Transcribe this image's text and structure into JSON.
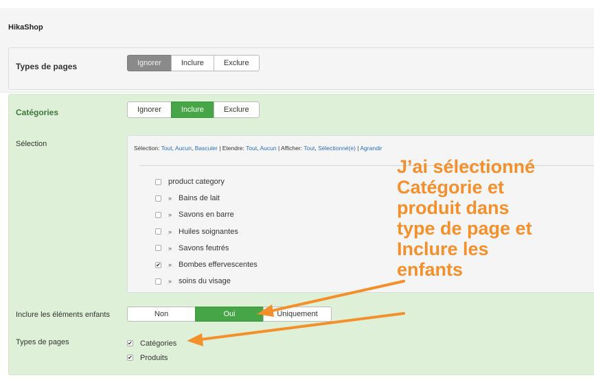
{
  "header": {
    "app_title": "HikaShop"
  },
  "types_section": {
    "label": "Types de pages",
    "options": [
      "Ignorer",
      "Inclure",
      "Exclure"
    ],
    "selected": "Ignorer"
  },
  "categories_section": {
    "label": "Catégories",
    "options": [
      "Ignorer",
      "Inclure",
      "Exclure"
    ],
    "selected": "Inclure",
    "selection_label": "Sélection",
    "toolbar": {
      "selection_prefix": "Sélection:",
      "tout": "Tout",
      "aucun": "Aucun",
      "basculer": "Basculer",
      "etendre_prefix": "Etendre:",
      "etendre_tout": "Tout",
      "etendre_aucun": "Aucun",
      "afficher_prefix": "Afficher:",
      "afficher_tout": "Tout",
      "selectionnes": "Sélectionné(e)",
      "agrandir": "Agrandir"
    },
    "tree": [
      {
        "label": "product category",
        "child": false,
        "checked": false
      },
      {
        "label": "Bains de lait",
        "child": true,
        "checked": false
      },
      {
        "label": "Savons en barre",
        "child": true,
        "checked": false
      },
      {
        "label": "Huiles soignantes",
        "child": true,
        "checked": false
      },
      {
        "label": "Savons feutrés",
        "child": true,
        "checked": false
      },
      {
        "label": "Bombes effervescentes",
        "child": true,
        "checked": true
      },
      {
        "label": "soins du visage",
        "child": true,
        "checked": false
      }
    ],
    "include_children": {
      "label": "Inclure les éléments enfants",
      "options": [
        "Non",
        "Oui",
        "Uniquement"
      ],
      "selected": "Oui"
    },
    "page_types": {
      "label": "Types de pages",
      "items": [
        {
          "label": "Catégories",
          "checked": true
        },
        {
          "label": "Produits",
          "checked": true
        }
      ]
    }
  },
  "annotation": {
    "lines": [
      "J’ai sélectionné",
      "Catégorie et",
      "produit dans",
      "type de page et",
      "Inclure les",
      "enfants"
    ],
    "color": "#f3902c"
  },
  "colors": {
    "green_active": "#46a546",
    "grey_active": "#8a8a8a",
    "panel_green": "#dff0d8",
    "link": "#2a6eb8"
  }
}
